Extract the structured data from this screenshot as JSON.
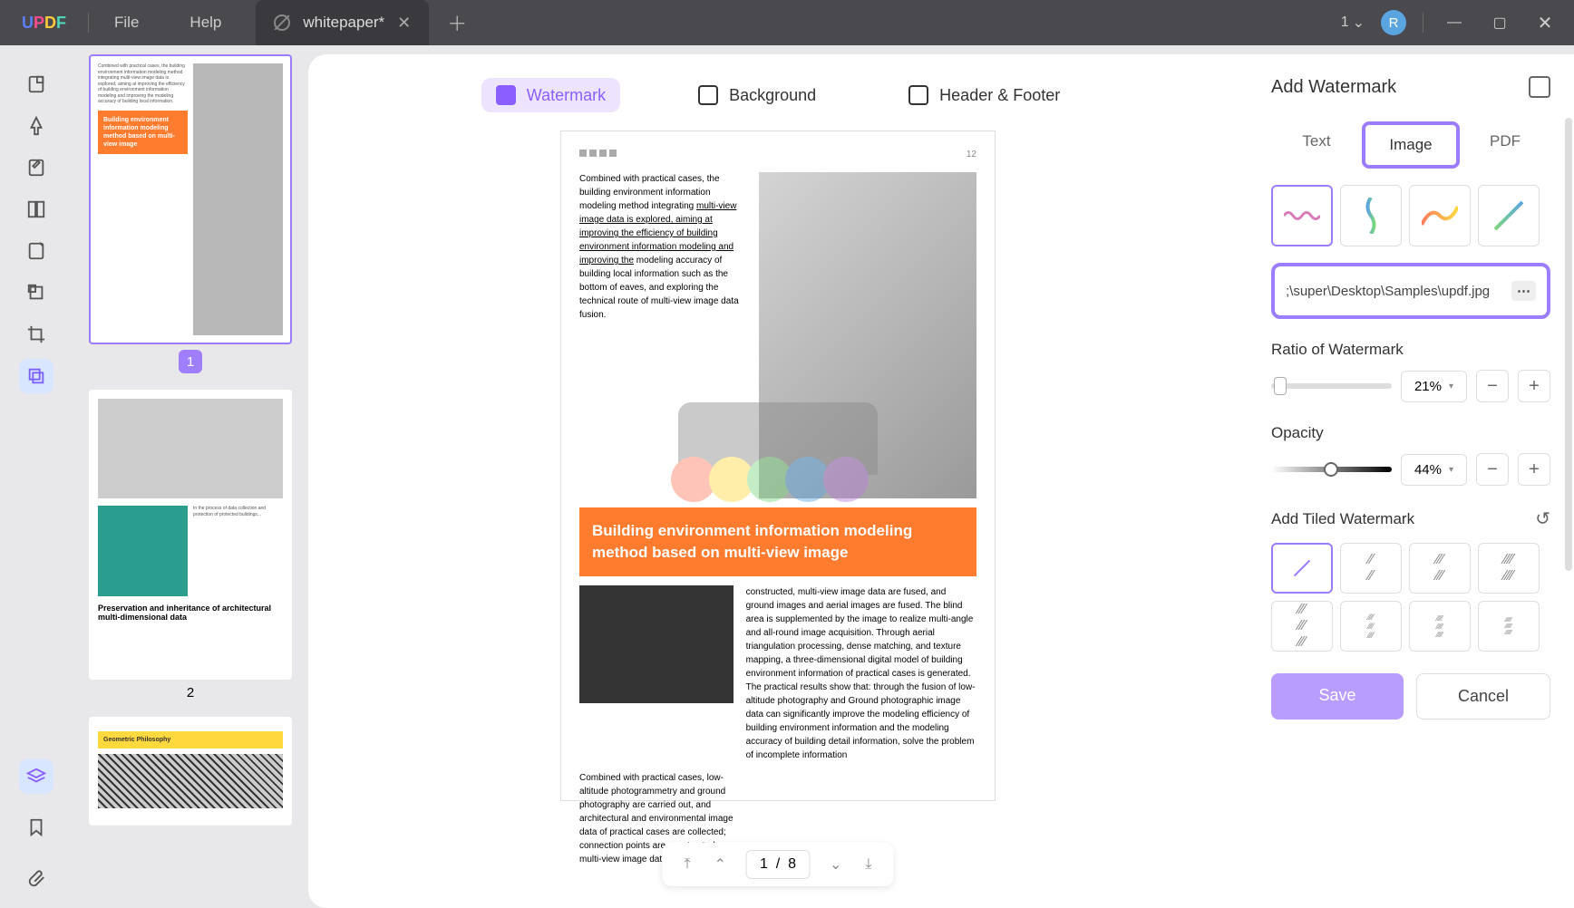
{
  "titlebar": {
    "logo": "UPDF",
    "menu": {
      "file": "File",
      "help": "Help"
    },
    "tab": {
      "title": "whitepaper*"
    },
    "count": "1",
    "avatar": "R"
  },
  "top_tabs": {
    "watermark": "Watermark",
    "background": "Background",
    "header_footer": "Header & Footer"
  },
  "doc": {
    "page_num": "12",
    "para1": "Combined with practical cases, the building environment information modeling method integrating ",
    "para1_u": "multi-view image data is explored, aiming at improving the efficiency of building environment information modeling and improving the",
    "para1_after": " modeling accuracy of building local information such as the bottom of eaves, and exploring the technical route of multi-view image data fusion.",
    "banner": "Building environment information modeling method based on multi-view image",
    "para2": "constructed, multi-view image data are fused, and ground images and aerial images are fused. The blind area is supplemented by the image to realize multi-angle and all-round image acquisition. Through aerial triangulation processing, dense matching, and texture mapping, a three-dimensional digital model of building environment information of practical cases is generated. The practical results show that: through the fusion of low-altitude photography and Ground photographic image data can significantly improve the modeling efficiency of building environment information and the modeling accuracy of building detail information, solve the problem of incomplete information",
    "para3": "Combined with practical cases, low-altitude photogrammetry and ground photography are carried out, and architectural and environmental image data of practical cases are collected; connection points are constructed, multi-view image data are"
  },
  "thumbs": {
    "p1": "1",
    "p2": "2",
    "t1_banner": "Building environment information modeling method based on multi-view image",
    "t2_title": "Preservation and inheritance of architectural multi-dimensional data",
    "t3_title": "Geometric Philosophy"
  },
  "nav": {
    "page": "1",
    "total": "8",
    "sep": "/"
  },
  "right": {
    "title": "Add Watermark",
    "tabs": {
      "text": "Text",
      "image": "Image",
      "pdf": "PDF"
    },
    "file_path": ";\\super\\Desktop\\Samples\\updf.jpg",
    "ratio_label": "Ratio of Watermark",
    "ratio_val": "21%",
    "opacity_label": "Opacity",
    "opacity_val": "44%",
    "tile_label": "Add Tiled Watermark",
    "save": "Save",
    "cancel": "Cancel"
  }
}
